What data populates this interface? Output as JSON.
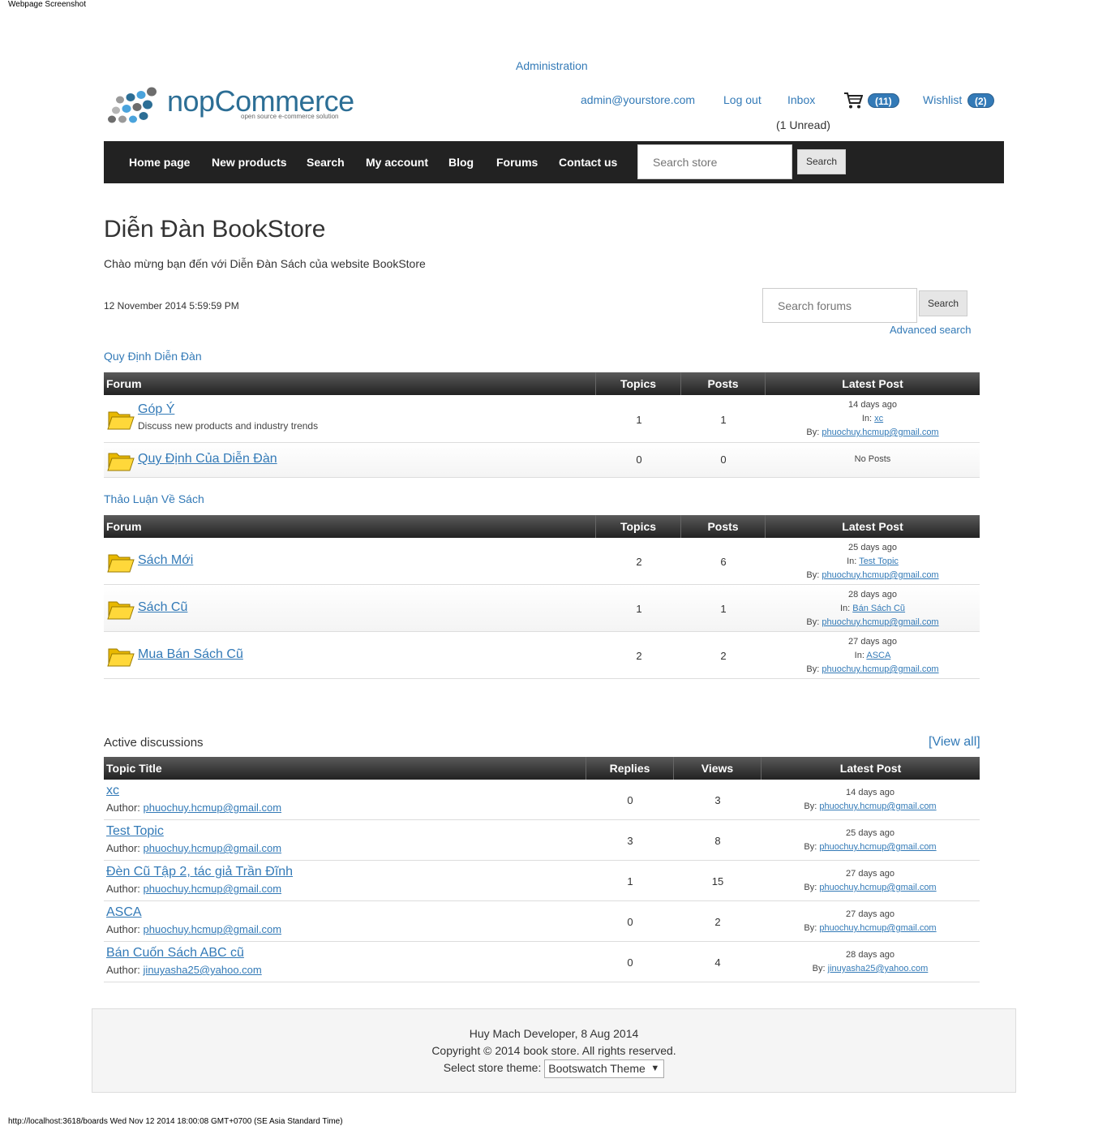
{
  "screenshot_label": "Webpage Screenshot",
  "header": {
    "administration": "Administration",
    "logo_text": "nopCommerce",
    "logo_sub": "open source e-commerce solution",
    "account_email": "admin@yourstore.com",
    "logout": "Log out",
    "inbox": "Inbox",
    "inbox_unread": "(1 Unread)",
    "cart_count": "(11)",
    "wishlist": "Wishlist",
    "wishlist_count": "(2)"
  },
  "nav": {
    "items": [
      "Home page",
      "New products",
      "Search",
      "My account",
      "Blog",
      "Forums",
      "Contact us"
    ],
    "search_placeholder": "Search store",
    "search_button": "Search"
  },
  "page": {
    "title": "Diễn Đàn BookStore",
    "subtitle": "Chào mừng bạn đến với Diễn Đàn Sách của website BookStore",
    "date": "12 November 2014 5:59:59 PM",
    "forum_search_placeholder": "Search forums",
    "forum_search_button": "Search",
    "advanced_search": "Advanced search"
  },
  "forum_headers": {
    "forum": "Forum",
    "topics": "Topics",
    "posts": "Posts",
    "latest": "Latest Post"
  },
  "groups": [
    {
      "title": "Quy Định Diễn Đàn",
      "forums": [
        {
          "name": "Góp Ý",
          "desc": "Discuss new products and industry trends",
          "topics": "1",
          "posts": "1",
          "ago": "14 days ago",
          "in_label": "In:",
          "in_topic": "xc",
          "by_label": "By:",
          "by": "phuochuy.hcmup@gmail.com"
        },
        {
          "name": "Quy Định Của Diễn Đàn",
          "topics": "0",
          "posts": "0",
          "no_posts": "No Posts"
        }
      ]
    },
    {
      "title": "Thảo Luận Về Sách",
      "forums": [
        {
          "name": "Sách Mới",
          "topics": "2",
          "posts": "6",
          "ago": "25 days ago",
          "in_label": "In:",
          "in_topic": "Test Topic",
          "by_label": "By:",
          "by": "phuochuy.hcmup@gmail.com"
        },
        {
          "name": "Sách Cũ",
          "topics": "1",
          "posts": "1",
          "ago": "28 days ago",
          "in_label": "In:",
          "in_topic": "Bán Sách Cũ",
          "by_label": "By:",
          "by": "phuochuy.hcmup@gmail.com"
        },
        {
          "name": "Mua Bán Sách Cũ",
          "topics": "2",
          "posts": "2",
          "ago": "27 days ago",
          "in_label": "In:",
          "in_topic": "ASCA",
          "by_label": "By:",
          "by": "phuochuy.hcmup@gmail.com"
        }
      ]
    }
  ],
  "active": {
    "title": "Active discussions",
    "view_all": "[View all]",
    "headers": {
      "topic": "Topic Title",
      "replies": "Replies",
      "views": "Views",
      "latest": "Latest Post"
    },
    "author_label": "Author:",
    "by_label": "By:",
    "topics": [
      {
        "name": "xc",
        "author": "phuochuy.hcmup@gmail.com",
        "replies": "0",
        "views": "3",
        "ago": "14 days ago",
        "by": "phuochuy.hcmup@gmail.com"
      },
      {
        "name": "Test Topic",
        "author": "phuochuy.hcmup@gmail.com",
        "replies": "3",
        "views": "8",
        "ago": "25 days ago",
        "by": "phuochuy.hcmup@gmail.com"
      },
      {
        "name": "Đèn Cũ Tập 2, tác giả Trần Đĩnh",
        "author": "phuochuy.hcmup@gmail.com",
        "replies": "1",
        "views": "15",
        "ago": "27 days ago",
        "by": "phuochuy.hcmup@gmail.com"
      },
      {
        "name": "ASCA",
        "author": "phuochuy.hcmup@gmail.com",
        "replies": "0",
        "views": "2",
        "ago": "27 days ago",
        "by": "phuochuy.hcmup@gmail.com"
      },
      {
        "name": "Bán Cuốn Sách ABC cũ",
        "author": "jinuyasha25@yahoo.com",
        "replies": "0",
        "views": "4",
        "ago": "28 days ago",
        "by": "jinuyasha25@yahoo.com"
      }
    ]
  },
  "footer": {
    "line1": "Huy Mach Developer, 8 Aug 2014",
    "line2": "Copyright © 2014 book store. All rights reserved.",
    "theme_label": "Select store theme:",
    "theme_value": "Bootswatch Theme"
  },
  "status_bar": "http://localhost:3618/boards Wed Nov 12 2014 18:00:08 GMT+0700 (SE Asia Standard Time)",
  "colors": {
    "link": "#337ab7",
    "navbar": "#222222",
    "badge": "#337ab7"
  }
}
